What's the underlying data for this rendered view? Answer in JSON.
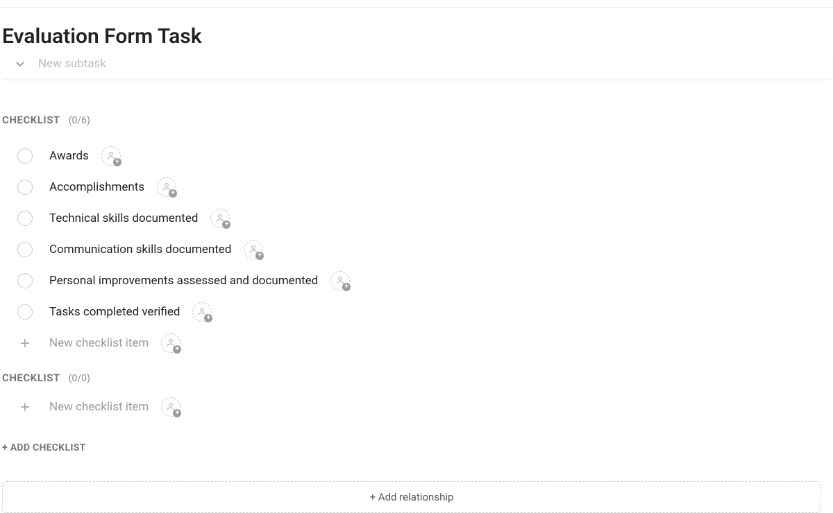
{
  "page": {
    "title": "Evaluation Form Task"
  },
  "subtask": {
    "placeholder": "New subtask"
  },
  "checklist1": {
    "label": "CHECKLIST",
    "count": "(0/6)",
    "items": [
      "Awards",
      "Accomplishments",
      "Technical skills documented",
      "Communication skills documented",
      "Personal improvements assessed and documented",
      "Tasks completed verified"
    ],
    "new_item_placeholder": "New checklist item"
  },
  "checklist2": {
    "label": "CHECKLIST",
    "count": "(0/0)",
    "new_item_placeholder": "New checklist item"
  },
  "add_checklist_label": "+ ADD CHECKLIST",
  "add_relationship_label": "+ Add relationship"
}
